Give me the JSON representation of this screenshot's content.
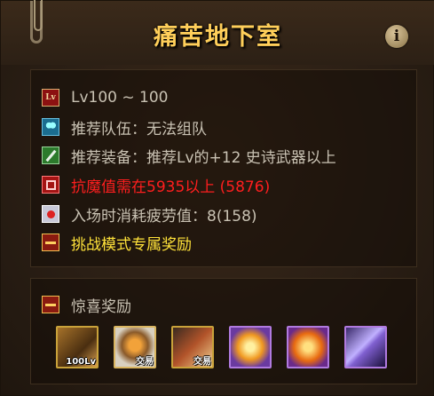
{
  "title": "痛苦地下室",
  "info_icon": "info-icon",
  "requirements": [
    {
      "icon": "level-icon",
      "text": "Lv100 ~ 100",
      "color": "#c9c2b3"
    },
    {
      "icon": "team-icon",
      "text": "推荐队伍：无法组队",
      "color": "#c9c2b3"
    },
    {
      "icon": "equipment-icon",
      "text": "推荐装备：推荐Lv的+12 史诗武器以上",
      "color": "#c9c2b3"
    },
    {
      "icon": "magic-resist-icon",
      "text": "抗魔值需在5935以上 (5876)",
      "color": "#ff1e1e"
    },
    {
      "icon": "fatigue-icon",
      "text": "入场时消耗疲劳值：8(158)",
      "color": "#c9c2b3"
    },
    {
      "icon": "chest-icon",
      "text": "挑战模式专属奖励",
      "color": "#ffe23a"
    }
  ],
  "bonus": {
    "icon": "chest-icon",
    "label": "惊喜奖励",
    "items": [
      {
        "icon": "weapon-box-icon",
        "badge": "100Lv"
      },
      {
        "icon": "gear-material-icon",
        "badge": "交易"
      },
      {
        "icon": "weapon-material-icon",
        "badge": "交易"
      },
      {
        "icon": "purple-orb-icon",
        "badge": ""
      },
      {
        "icon": "fire-orb-icon",
        "badge": ""
      },
      {
        "icon": "crystal-shard-icon",
        "badge": ""
      }
    ]
  },
  "colors": {
    "title": "#ffcf5a",
    "gray_text": "#c9c2b3",
    "red_text": "#ff1e1e",
    "yellow_text": "#ffe23a"
  }
}
